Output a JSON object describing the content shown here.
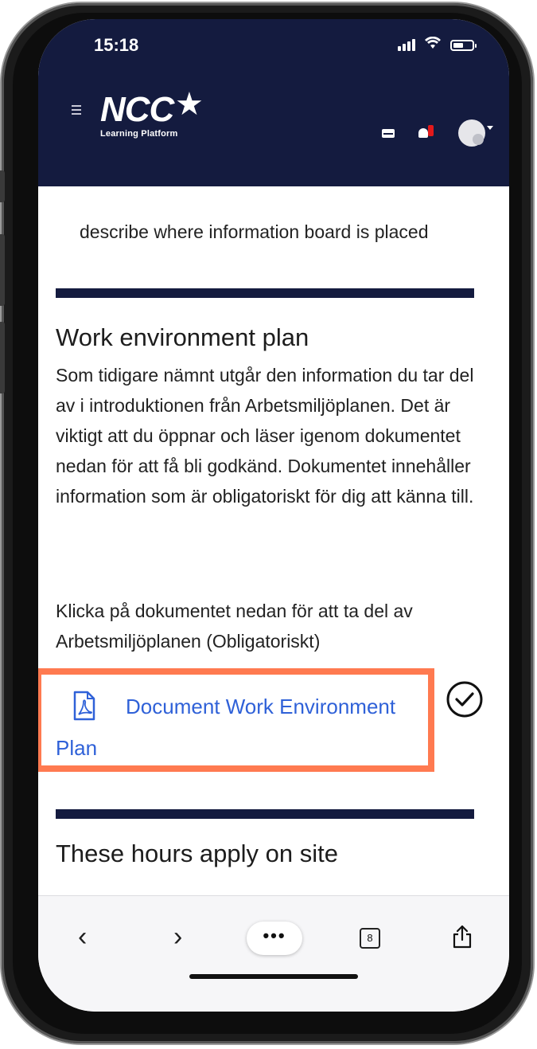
{
  "status_bar": {
    "time": "15:18",
    "icons": [
      "signal-icon",
      "wifi-icon",
      "battery-icon"
    ]
  },
  "header": {
    "logo_main": "NCC",
    "logo_sub": "Learning Platform",
    "icons": [
      "menu-icon",
      "mail-icon",
      "bell-icon",
      "avatar"
    ],
    "notification_badge_color": "#e3191b",
    "background_color": "#141b3f"
  },
  "content": {
    "info_text": "describe where information board is placed",
    "section1": {
      "title": "Work environment plan",
      "paragraph": "Som tidigare nämnt utgår den information du tar del av i introduktionen från Arbetsmiljöplanen. Det är viktigt att du öppnar och läser igenom dokumentet nedan för att få bli godkänd. Dokumentet innehåller information som är obligatoriskt för dig att känna till.",
      "instruction": "Klicka på dokumentet nedan för att ta del av Arbetsmiljöplanen (Obligatoriskt)",
      "document_link": "Document Work Environment Plan",
      "document_icon": "pdf-icon",
      "status_icon": "check-circle-icon",
      "highlight_color": "#ff7a50",
      "link_color": "#2f61d8"
    },
    "section2": {
      "title": "These hours apply on site"
    }
  },
  "browser_toolbar": {
    "back": "‹",
    "forward": "›",
    "more": "•••",
    "tab_count": "8",
    "share_icon": "share-icon"
  }
}
